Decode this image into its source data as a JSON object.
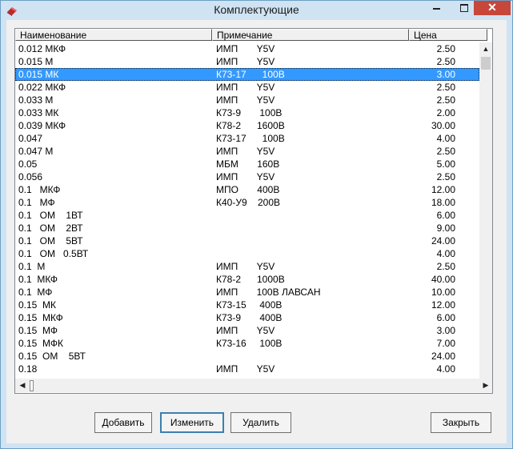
{
  "window": {
    "title": "Комплектующие",
    "close_glyph": "✕"
  },
  "table": {
    "headers": [
      "Наименование",
      "Примечание",
      "Цена"
    ],
    "rows": [
      {
        "name": "0.012 МКФ",
        "note": "ИМП       Y5V",
        "price": "2.50"
      },
      {
        "name": "0.015 М",
        "note": "ИМП       Y5V",
        "price": "2.50"
      },
      {
        "name": "0.015 МК",
        "note": "К73-17      100В",
        "price": "3.00"
      },
      {
        "name": "0.022 МКФ",
        "note": "ИМП       Y5V",
        "price": "2.50"
      },
      {
        "name": "0.033 М",
        "note": "ИМП       Y5V",
        "price": "2.50"
      },
      {
        "name": "0.033 МК",
        "note": "К73-9       100В",
        "price": "2.00"
      },
      {
        "name": "0.039 МКФ",
        "note": "К78-2      1600В",
        "price": "30.00"
      },
      {
        "name": "0.047",
        "note": "К73-17      100В",
        "price": "4.00"
      },
      {
        "name": "0.047 М",
        "note": "ИМП       Y5V",
        "price": "2.50"
      },
      {
        "name": "0.05",
        "note": "МБМ       160В",
        "price": "5.00"
      },
      {
        "name": "0.056",
        "note": "ИМП       Y5V",
        "price": "2.50"
      },
      {
        "name": "0.1   МКФ",
        "note": "МПО       400В",
        "price": "12.00"
      },
      {
        "name": "0.1   МФ",
        "note": "К40-У9    200В",
        "price": "18.00"
      },
      {
        "name": "0.1   ОМ    1ВТ",
        "note": "",
        "price": "6.00"
      },
      {
        "name": "0.1   ОМ    2ВТ",
        "note": "",
        "price": "9.00"
      },
      {
        "name": "0.1   ОМ    5ВТ",
        "note": "",
        "price": "24.00"
      },
      {
        "name": "0.1   ОМ   0.5ВТ",
        "note": "",
        "price": "4.00"
      },
      {
        "name": "0.1  М",
        "note": "ИМП       Y5V",
        "price": "2.50"
      },
      {
        "name": "0.1  МКФ",
        "note": "К78-2      1000В",
        "price": "40.00"
      },
      {
        "name": "0.1  МФ",
        "note": "ИМП       100В ЛАВСАН",
        "price": "10.00"
      },
      {
        "name": "0.15  МК",
        "note": "К73-15     400В",
        "price": "12.00"
      },
      {
        "name": "0.15  МКФ",
        "note": "К73-9       400В",
        "price": "6.00"
      },
      {
        "name": "0.15  МФ",
        "note": "ИМП       Y5V",
        "price": "3.00"
      },
      {
        "name": "0.15  МФК",
        "note": "К73-16     100В",
        "price": "7.00"
      },
      {
        "name": "0.15  ОМ    5ВТ",
        "note": "",
        "price": "24.00"
      },
      {
        "name": "0.18",
        "note": "ИМП       Y5V",
        "price": "4.00"
      }
    ],
    "selected_index": 2
  },
  "buttons": {
    "add": {
      "label": "Добавить"
    },
    "edit": {
      "label": "Изменить"
    },
    "delete": {
      "label": "Удалить"
    },
    "close": {
      "label": "Закрыть"
    }
  }
}
